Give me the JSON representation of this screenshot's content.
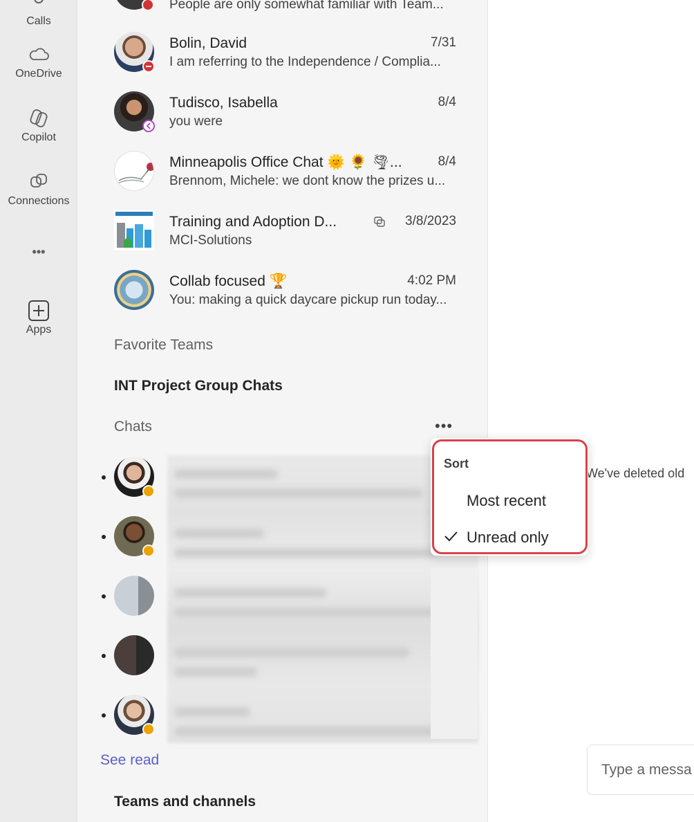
{
  "rail": {
    "items": [
      {
        "label": "Calls",
        "icon": "phone-icon"
      },
      {
        "label": "OneDrive",
        "icon": "cloud-icon"
      },
      {
        "label": "Copilot",
        "icon": "copilot-icon"
      },
      {
        "label": "Connections",
        "icon": "connections-icon"
      },
      {
        "label": "•••",
        "icon": "more-icon"
      },
      {
        "label": "Apps",
        "icon": "plus-icon"
      }
    ]
  },
  "chats": [
    {
      "name": "",
      "time": "",
      "preview": "People are only somewhat familiar with Team...",
      "status": "busy"
    },
    {
      "name": "Bolin, David",
      "time": "7/31",
      "preview": "I am referring to the Independence / Complia...",
      "status": "dnd"
    },
    {
      "name": "Tudisco, Isabella",
      "time": "8/4",
      "preview": "you were",
      "status": "out-of-office"
    },
    {
      "name": "Minneapolis Office Chat 🌞 🌻 🌪...",
      "time": "8/4",
      "preview": "Brennom, Michele: we dont know the prizes u...",
      "status": ""
    },
    {
      "name": "Training and Adoption D...",
      "time": "3/8/2023",
      "preview": "MCI-Solutions",
      "status": ""
    },
    {
      "name": "Collab focused 🏆",
      "time": "4:02 PM",
      "preview": "You: making a quick daycare pickup run today...",
      "status": ""
    }
  ],
  "sections": {
    "favorite_teams": "Favorite Teams",
    "int_project": "INT Project Group Chats",
    "chats": "Chats",
    "teams_channels": "Teams and channels",
    "see_read": "See read"
  },
  "menu": {
    "header": "Sort",
    "options": [
      {
        "label": "Most recent",
        "checked": false
      },
      {
        "label": "Unread only",
        "checked": true
      }
    ]
  },
  "main": {
    "deleted_note": "We've deleted old",
    "compose_placeholder": "Type a messa"
  },
  "colors": {
    "accent": "#5b5fc7",
    "highlight": "#d9424a",
    "away": "#eaa300",
    "busy": "#d13438"
  }
}
